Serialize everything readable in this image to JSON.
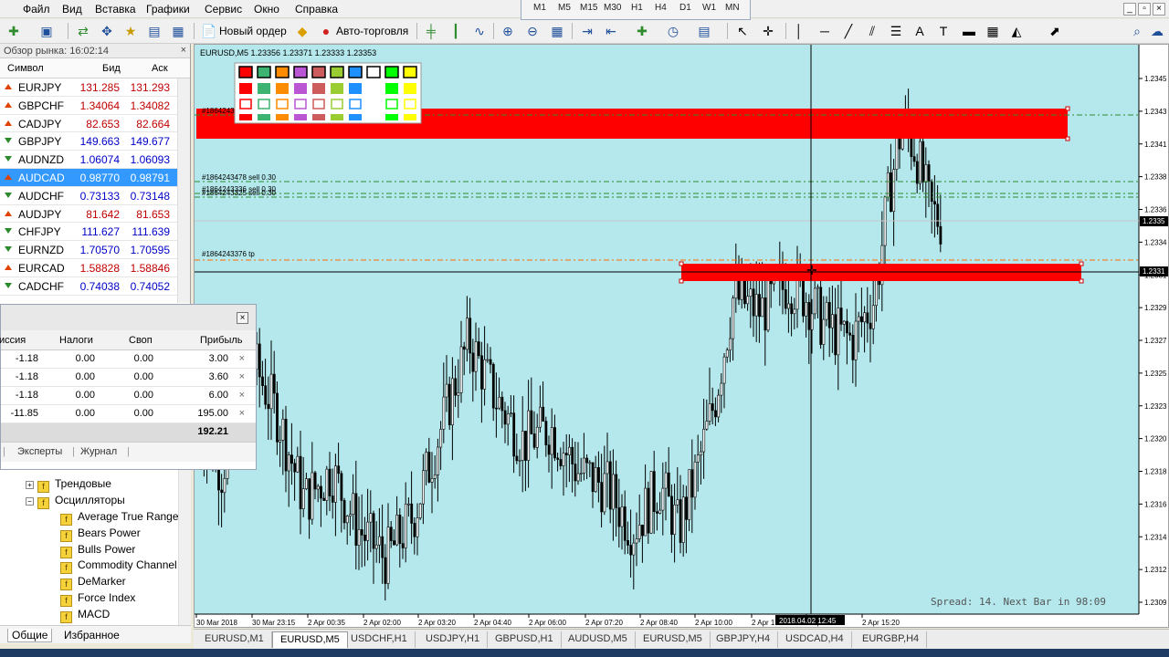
{
  "menu": [
    "Файл",
    "Вид",
    "Вставка",
    "Графики",
    "Сервис",
    "Окно",
    "Справка"
  ],
  "timeframes": [
    "M1",
    "M5",
    "M15",
    "M30",
    "H1",
    "H4",
    "D1",
    "W1",
    "MN"
  ],
  "toolbar": {
    "new_order": "Новый ордер",
    "autotrade": "Авто-торговля"
  },
  "market_watch": {
    "title": "Обзор рынка: 16:02:14",
    "headers": {
      "symbol": "Символ",
      "bid": "Бид",
      "ask": "Аск"
    },
    "rows": [
      {
        "symbol": "EURJPY",
        "bid": "131.285",
        "ask": "131.293",
        "dir": "up",
        "color": "red"
      },
      {
        "symbol": "GBPCHF",
        "bid": "1.34064",
        "ask": "1.34082",
        "dir": "up",
        "color": "red"
      },
      {
        "symbol": "CADJPY",
        "bid": "82.653",
        "ask": "82.664",
        "dir": "up",
        "color": "red"
      },
      {
        "symbol": "GBPJPY",
        "bid": "149.663",
        "ask": "149.677",
        "dir": "dn",
        "color": "blue"
      },
      {
        "symbol": "AUDNZD",
        "bid": "1.06074",
        "ask": "1.06093",
        "dir": "dn",
        "color": "blue"
      },
      {
        "symbol": "AUDCAD",
        "bid": "0.98770",
        "ask": "0.98791",
        "dir": "up",
        "color": "blue",
        "selected": true
      },
      {
        "symbol": "AUDCHF",
        "bid": "0.73133",
        "ask": "0.73148",
        "dir": "dn",
        "color": "blue"
      },
      {
        "symbol": "AUDJPY",
        "bid": "81.642",
        "ask": "81.653",
        "dir": "up",
        "color": "red"
      },
      {
        "symbol": "CHFJPY",
        "bid": "111.627",
        "ask": "111.639",
        "dir": "dn",
        "color": "blue"
      },
      {
        "symbol": "EURNZD",
        "bid": "1.70570",
        "ask": "1.70595",
        "dir": "dn",
        "color": "blue"
      },
      {
        "symbol": "EURCAD",
        "bid": "1.58828",
        "ask": "1.58846",
        "dir": "up",
        "color": "red"
      },
      {
        "symbol": "CADCHF",
        "bid": "0.74038",
        "ask": "0.74052",
        "dir": "dn",
        "color": "blue"
      }
    ]
  },
  "terminal": {
    "headers": {
      "commission": "иссия",
      "taxes": "Налоги",
      "swap": "Своп",
      "profit": "Прибыль"
    },
    "rows": [
      {
        "commission": "-1.18",
        "taxes": "0.00",
        "swap": "0.00",
        "profit": "3.00"
      },
      {
        "commission": "-1.18",
        "taxes": "0.00",
        "swap": "0.00",
        "profit": "3.60"
      },
      {
        "commission": "-1.18",
        "taxes": "0.00",
        "swap": "0.00",
        "profit": "6.00"
      },
      {
        "commission": "-11.85",
        "taxes": "0.00",
        "swap": "0.00",
        "profit": "195.00"
      }
    ],
    "total": "192.21",
    "tabs": [
      "Эксперты",
      "Журнал"
    ]
  },
  "navigator": {
    "groups": [
      "Трендовые",
      "Осцилляторы"
    ],
    "items": [
      "Average True Range",
      "Bears Power",
      "Bulls Power",
      "Commodity Channel",
      "DeMarker",
      "Force Index",
      "MACD"
    ],
    "tabs": {
      "general": "Общие",
      "favorites": "Избранное"
    }
  },
  "chart": {
    "title": "EURUSD,M5  1.23356 1.23371 1.23333 1.23353",
    "background": "#b4e8ec",
    "price_labels": [
      "1.2345",
      "1.2343",
      "1.2341",
      "1.2338",
      "1.2336",
      "1.2334",
      "1.2331",
      "1.2329",
      "1.2327",
      "1.2325",
      "1.2323",
      "1.2320",
      "1.2318",
      "1.2316",
      "1.2314",
      "1.2312",
      "1.2309"
    ],
    "current_price": "1.2335",
    "cross_price": "1.2331",
    "time_labels": [
      "30 Mar 2018",
      "30 Mar 23:15",
      "2 Apr 00:35",
      "2 Apr 02:00",
      "2 Apr 03:20",
      "2 Apr 04:40",
      "2 Apr 06:00",
      "2 Apr 07:20",
      "2 Apr 08:40",
      "2 Apr 10:00",
      "2 Apr 1",
      "2 Apr 14:00",
      "2 Apr 15:20"
    ],
    "cross_time": "2018.04.02 12:45",
    "order_labels": [
      "#1864243325 sell 3.00",
      "#1864243478 sell 0.30",
      "#1864243336 sell 0.30",
      "#1864243325 sell 0.30",
      "#1864243376 tp"
    ],
    "spread_text": "Spread: 14. Next Bar in 98:09",
    "zone_color": "#ff0000",
    "palette": [
      "#ff0000",
      "#3cb371",
      "#ff8c00",
      "#ba55d3",
      "#cd5c5c",
      "#9acd32",
      "#1e90ff",
      "#ffffff",
      "#00ff00",
      "#ffff00"
    ]
  },
  "chart_tabs": [
    "EURUSD,M1",
    "EURUSD,M5",
    "USDCHF,H1",
    "USDJPY,H1",
    "GBPUSD,H1",
    "AUDUSD,M5",
    "EURUSD,M5",
    "GBPJPY,H4",
    "USDCAD,H4",
    "EURGBP,H4"
  ]
}
